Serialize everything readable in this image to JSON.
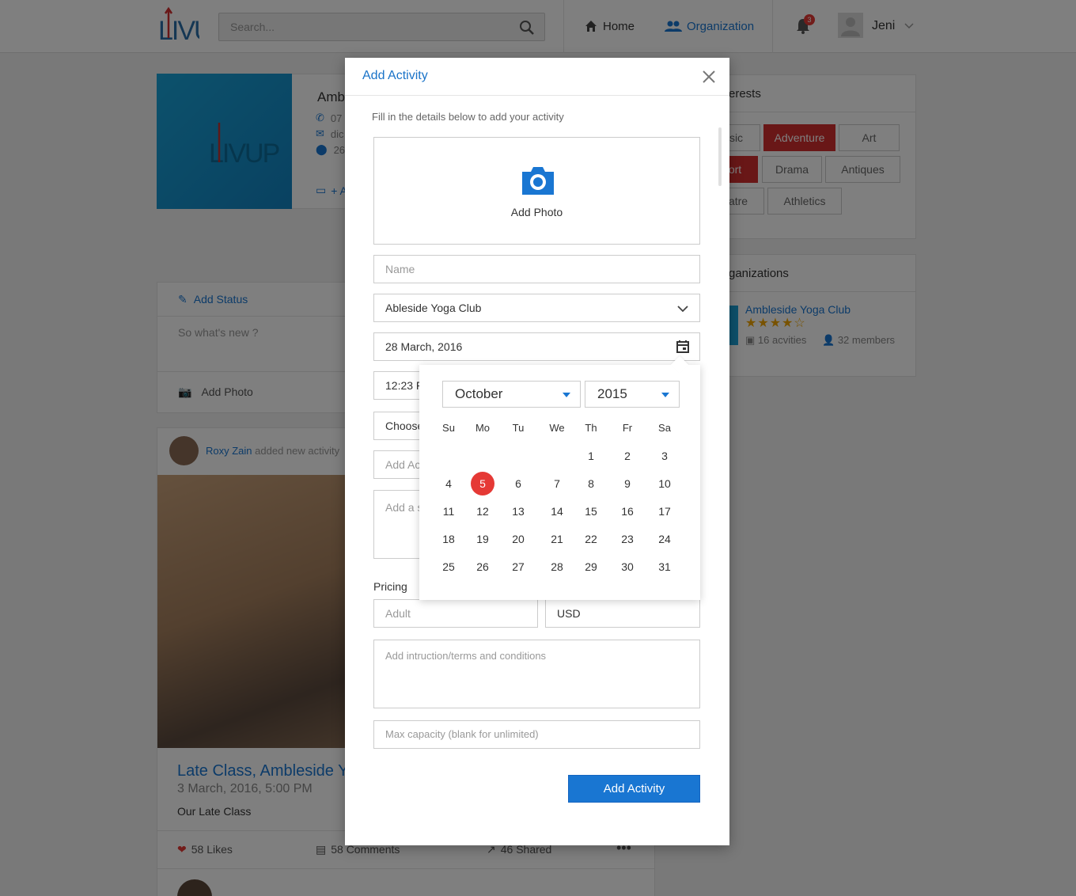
{
  "header": {
    "logo_text": "LIVUP",
    "search_placeholder": "Search...",
    "nav": {
      "home": "Home",
      "organization": "Organization"
    },
    "notification_count": "3",
    "user_name": "Jeni"
  },
  "background": {
    "profile": {
      "name_partial": "Amb",
      "phone_partial": "07",
      "email_partial": "dic",
      "address_partial": "26",
      "add_link_partial": "+ A"
    },
    "interests": {
      "title_partial": "erests",
      "tags": [
        "sic",
        "Adventure",
        "Art",
        "ort",
        "Drama",
        "Antiques",
        "atre",
        "Athletics"
      ]
    },
    "organizations": {
      "title_partial": "ganizations",
      "org_name": "Ambleside Yoga Club",
      "rating": 4,
      "activities": "16 acvities",
      "members": "32 members"
    },
    "status": {
      "add_status": "Add Status",
      "placeholder": "So what's new ?",
      "add_photo": "Add Photo"
    },
    "post": {
      "author": "Roxy Zain",
      "action": "added new activity",
      "title": "Late Class, Ambleside Y",
      "date": "3 March, 2016, 5:00 PM",
      "description": "Our Late Class",
      "likes": "58 Likes",
      "comments": "58 Comments",
      "shared": "46 Shared"
    }
  },
  "modal": {
    "title": "Add Activity",
    "intro": "Fill in the details below to add your activity",
    "add_photo": "Add Photo",
    "name_placeholder": "Name",
    "organization_value": "Ableside Yoga Club",
    "date_value": "28 March, 2016",
    "time_value_partial": "12:23 F",
    "choose_partial": "Choose",
    "add_activity_partial": "Add Ac",
    "add_summary_partial": "Add a s",
    "pricing_label": "Pricing",
    "adult_placeholder": "Adult",
    "currency_value": "USD",
    "terms_placeholder": "Add intruction/terms and conditions",
    "capacity_placeholder": "Max capacity (blank for unlimited)",
    "submit": "Add Activity"
  },
  "calendar": {
    "month": "October",
    "year": "2015",
    "weekdays": [
      "Su",
      "Mo",
      "Tu",
      "We",
      "Th",
      "Fr",
      "Sa"
    ],
    "weeks": [
      [
        "",
        "",
        "",
        "",
        "1",
        "2",
        "3"
      ],
      [
        "4",
        "5",
        "6",
        "7",
        "8",
        "9",
        "10"
      ],
      [
        "11",
        "12",
        "13",
        "14",
        "15",
        "16",
        "17"
      ],
      [
        "18",
        "19",
        "20",
        "21",
        "22",
        "23",
        "24"
      ],
      [
        "25",
        "26",
        "27",
        "28",
        "29",
        "30",
        "31"
      ]
    ],
    "selected_day": "5"
  },
  "colors": {
    "accent": "#1976d2",
    "danger": "#e53935",
    "brand_cyan": "#1aa3d8"
  }
}
